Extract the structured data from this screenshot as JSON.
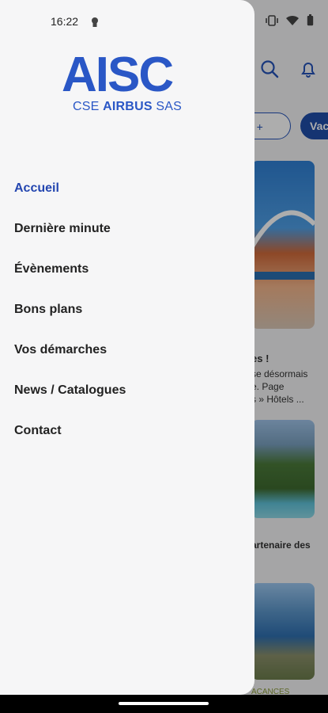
{
  "status": {
    "time": "16:22"
  },
  "logo": {
    "main": "AISC",
    "sub_prefix": "CSE",
    "sub_bold": "AIRBUS",
    "sub_suffix": "SAS"
  },
  "menu": {
    "items": [
      {
        "label": "Accueil",
        "active": true
      },
      {
        "label": "Dernière minute"
      },
      {
        "label": "Évènements"
      },
      {
        "label": "Bons plans"
      },
      {
        "label": "Vos démarches"
      },
      {
        "label": "News / Catalogues"
      },
      {
        "label": "Contact"
      }
    ]
  },
  "background": {
    "chips": {
      "first": "e +",
      "second": "Vac"
    },
    "card1": {
      "title": "es !",
      "line1": "se désormais",
      "line2": "e. Page",
      "line3": "s » Hôtels ..."
    },
    "card2": {
      "title": "artenaire des"
    },
    "card3": {
      "tag": "ACANCES"
    }
  },
  "colors": {
    "accent": "#2446b0",
    "logo": "#2a57c6",
    "drawer_bg": "#f6f6f7"
  }
}
